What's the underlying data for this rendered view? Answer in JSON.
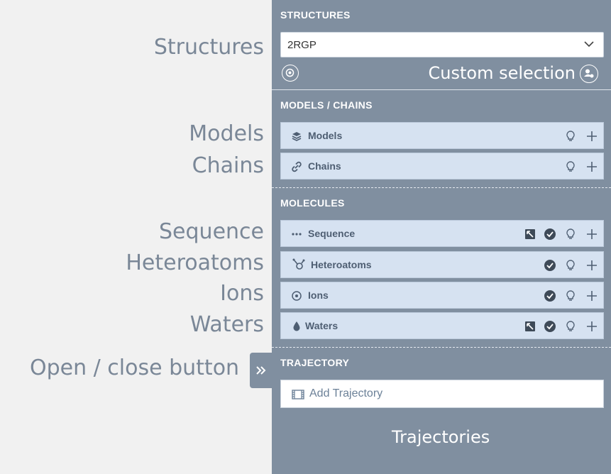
{
  "annotations": {
    "structures": "Structures",
    "models": "Models",
    "chains": "Chains",
    "sequence": "Sequence",
    "heteroatoms": "Heteroatoms",
    "ions": "Ions",
    "waters": "Waters",
    "toggle": "Open / close button",
    "custom_selection": "Custom selection",
    "trajectories": "Trajectories"
  },
  "panel": {
    "structures_title": "STRUCTURES",
    "structure_select": {
      "value": "2RGP"
    },
    "models_chains_title": "MODELS / CHAINS",
    "models_chains": [
      {
        "label": "Models",
        "icon": "layers-icon"
      },
      {
        "label": "Chains",
        "icon": "link-icon"
      }
    ],
    "molecules_title": "MOLECULES",
    "molecules": [
      {
        "label": "Sequence",
        "icon": "dots-icon"
      },
      {
        "label": "Heteroatoms",
        "icon": "hetero-icon"
      },
      {
        "label": "Ions",
        "icon": "ion-icon"
      },
      {
        "label": "Waters",
        "icon": "drop-icon"
      }
    ],
    "trajectory_title": "TRAJECTORY",
    "add_trajectory": "Add Trajectory"
  },
  "colors": {
    "panel_bg": "#808fa0",
    "row_bg": "#d6e2f1",
    "annotation_text": "#7a8797",
    "page_bg": "#f1f1f1"
  }
}
